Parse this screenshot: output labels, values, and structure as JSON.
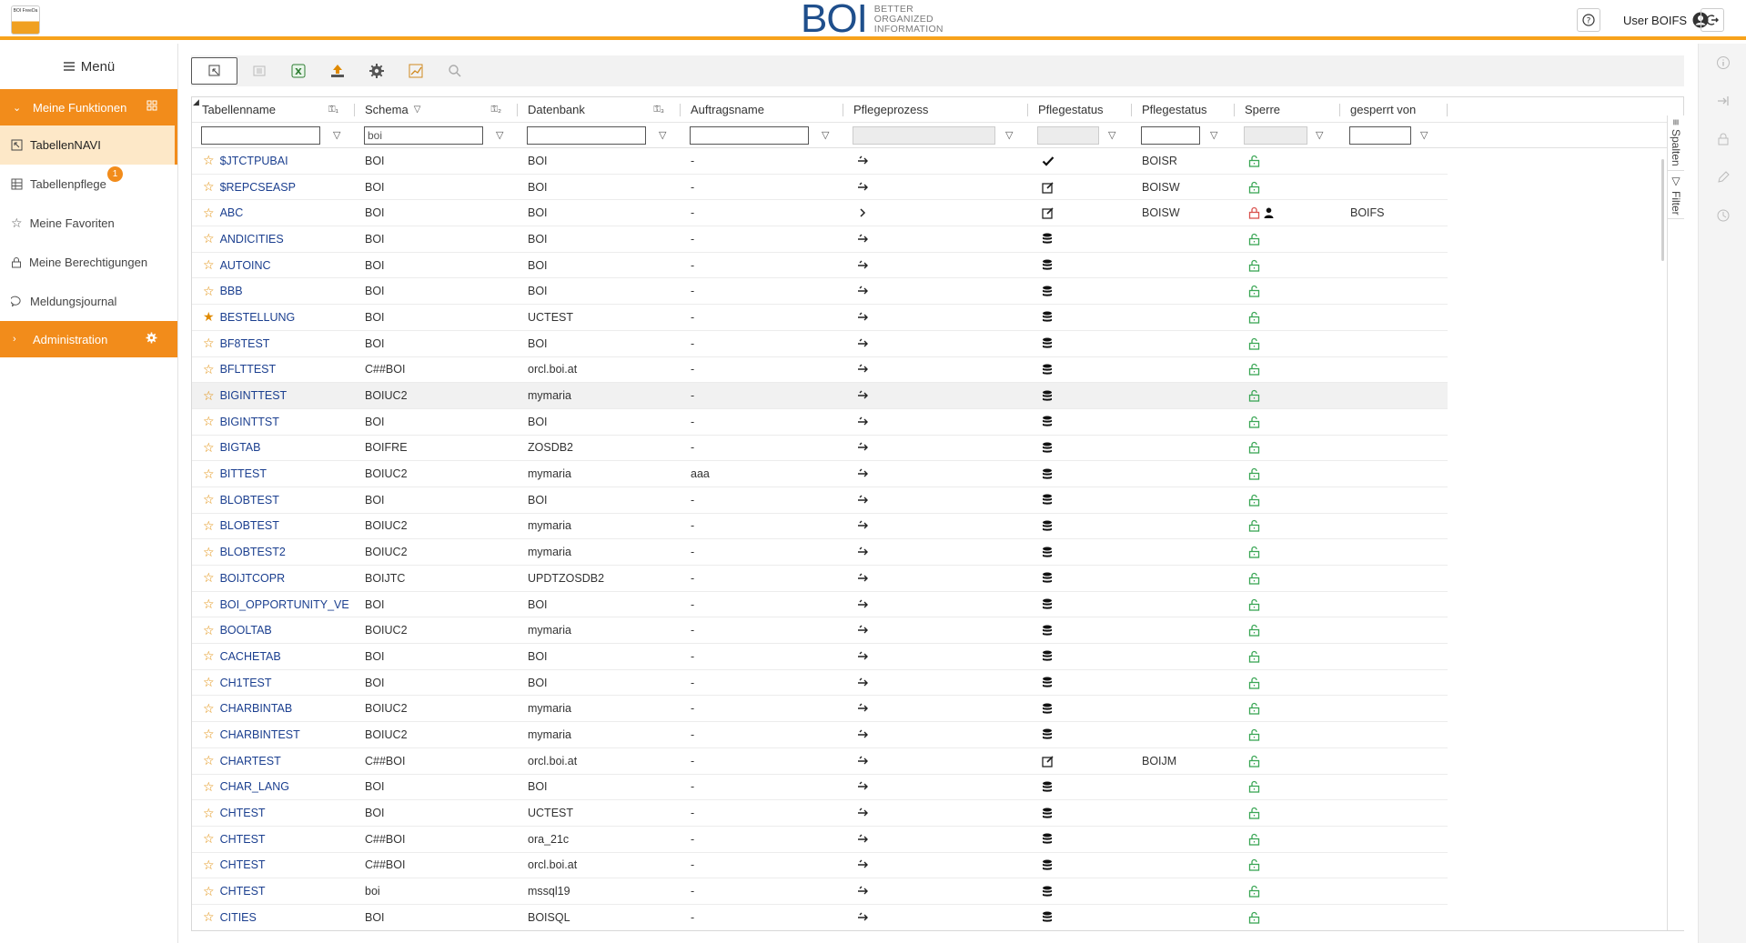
{
  "header": {
    "app_logo_text": "BOI FreeDa",
    "brand": "BOI",
    "brand_sub": [
      "BETTER",
      "ORGANIZED",
      "INFORMATION"
    ],
    "user_label": "User BOIFS"
  },
  "sidebar": {
    "menu_label": "Menü",
    "section_functions": "Meine Funktionen",
    "items": [
      {
        "label": "TabellenNAVI",
        "icon": "table-navi-icon",
        "active": true
      },
      {
        "label": "Tabellenpflege",
        "icon": "table-edit-icon",
        "badge": "1"
      },
      {
        "label": "Meine Favoriten",
        "icon": "star-icon"
      },
      {
        "label": "Meine Berechtigungen",
        "icon": "lock-icon"
      },
      {
        "label": "Meldungsjournal",
        "icon": "chat-icon"
      }
    ],
    "section_admin": "Administration"
  },
  "toolbar": {
    "buttons": [
      "select-mode",
      "details",
      "export-excel",
      "upload",
      "settings",
      "chart",
      "search"
    ]
  },
  "grid": {
    "columns": [
      "Tabellenname",
      "Schema",
      "Datenbank",
      "Auftragsname",
      "Pflegeprozess",
      "Pflegestatus",
      "Pflegestatus",
      "Sperre",
      "gesperrt von"
    ],
    "filters": {
      "schema_value": "boi"
    },
    "side_tabs": [
      "Spalten",
      "Filter"
    ],
    "rows": [
      {
        "name": "$JTCTPUBAI",
        "schema": "BOI",
        "db": "BOI",
        "auftrag": "-",
        "proc": "arrow",
        "status": "check",
        "status2": "BOISR",
        "lock": "open",
        "by": "",
        "fav": false
      },
      {
        "name": "$REPCSEASP",
        "schema": "BOI",
        "db": "BOI",
        "auftrag": "-",
        "proc": "arrow",
        "status": "edit",
        "status2": "BOISW",
        "lock": "open",
        "by": "",
        "fav": false
      },
      {
        "name": "ABC",
        "schema": "BOI",
        "db": "BOI",
        "auftrag": "-",
        "proc": "chevron",
        "status": "edit",
        "status2": "BOISW",
        "lock": "closed",
        "by": "BOIFS",
        "fav": false
      },
      {
        "name": "ANDICITIES",
        "schema": "BOI",
        "db": "BOI",
        "auftrag": "-",
        "proc": "arrow",
        "status": "db",
        "status2": "",
        "lock": "open",
        "by": "",
        "fav": false
      },
      {
        "name": "AUTOINC",
        "schema": "BOI",
        "db": "BOI",
        "auftrag": "-",
        "proc": "arrow",
        "status": "db",
        "status2": "",
        "lock": "open",
        "by": "",
        "fav": false
      },
      {
        "name": "BBB",
        "schema": "BOI",
        "db": "BOI",
        "auftrag": "-",
        "proc": "arrow",
        "status": "db",
        "status2": "",
        "lock": "open",
        "by": "",
        "fav": false
      },
      {
        "name": "BESTELLUNG",
        "schema": "BOI",
        "db": "UCTEST",
        "auftrag": "-",
        "proc": "arrow",
        "status": "db",
        "status2": "",
        "lock": "open",
        "by": "",
        "fav": true
      },
      {
        "name": "BF8TEST",
        "schema": "BOI",
        "db": "BOI",
        "auftrag": "-",
        "proc": "arrow",
        "status": "db",
        "status2": "",
        "lock": "open",
        "by": "",
        "fav": false
      },
      {
        "name": "BFLTTEST",
        "schema": "C##BOI",
        "db": "orcl.boi.at",
        "auftrag": "-",
        "proc": "arrow",
        "status": "db",
        "status2": "",
        "lock": "open",
        "by": "",
        "fav": false
      },
      {
        "name": "BIGINTTEST",
        "schema": "BOIUC2",
        "db": "mymaria",
        "auftrag": "-",
        "proc": "arrow",
        "status": "db",
        "status2": "",
        "lock": "open",
        "by": "",
        "fav": false,
        "hl": true
      },
      {
        "name": "BIGINTTST",
        "schema": "BOI",
        "db": "BOI",
        "auftrag": "-",
        "proc": "arrow",
        "status": "db",
        "status2": "",
        "lock": "open",
        "by": "",
        "fav": false
      },
      {
        "name": "BIGTAB",
        "schema": "BOIFRE",
        "db": "ZOSDB2",
        "auftrag": "-",
        "proc": "arrow",
        "status": "db",
        "status2": "",
        "lock": "open",
        "by": "",
        "fav": false
      },
      {
        "name": "BITTEST",
        "schema": "BOIUC2",
        "db": "mymaria",
        "auftrag": "aaa",
        "proc": "arrow",
        "status": "db",
        "status2": "",
        "lock": "open",
        "by": "",
        "fav": false
      },
      {
        "name": "BLOBTEST",
        "schema": "BOI",
        "db": "BOI",
        "auftrag": "-",
        "proc": "arrow",
        "status": "db",
        "status2": "",
        "lock": "open",
        "by": "",
        "fav": false
      },
      {
        "name": "BLOBTEST",
        "schema": "BOIUC2",
        "db": "mymaria",
        "auftrag": "-",
        "proc": "arrow",
        "status": "db",
        "status2": "",
        "lock": "open",
        "by": "",
        "fav": false
      },
      {
        "name": "BLOBTEST2",
        "schema": "BOIUC2",
        "db": "mymaria",
        "auftrag": "-",
        "proc": "arrow",
        "status": "db",
        "status2": "",
        "lock": "open",
        "by": "",
        "fav": false
      },
      {
        "name": "BOIJTCOPR",
        "schema": "BOIJTC",
        "db": "UPDTZOSDB2",
        "auftrag": "-",
        "proc": "arrow",
        "status": "db",
        "status2": "",
        "lock": "open",
        "by": "",
        "fav": false
      },
      {
        "name": "BOI_OPPORTUNITY_VE",
        "schema": "BOI",
        "db": "BOI",
        "auftrag": "-",
        "proc": "arrow",
        "status": "db",
        "status2": "",
        "lock": "open",
        "by": "",
        "fav": false
      },
      {
        "name": "BOOLTAB",
        "schema": "BOIUC2",
        "db": "mymaria",
        "auftrag": "-",
        "proc": "arrow",
        "status": "db",
        "status2": "",
        "lock": "open",
        "by": "",
        "fav": false
      },
      {
        "name": "CACHETAB",
        "schema": "BOI",
        "db": "BOI",
        "auftrag": "-",
        "proc": "arrow",
        "status": "db",
        "status2": "",
        "lock": "open",
        "by": "",
        "fav": false
      },
      {
        "name": "CH1TEST",
        "schema": "BOI",
        "db": "BOI",
        "auftrag": "-",
        "proc": "arrow",
        "status": "db",
        "status2": "",
        "lock": "open",
        "by": "",
        "fav": false
      },
      {
        "name": "CHARBINTAB",
        "schema": "BOIUC2",
        "db": "mymaria",
        "auftrag": "-",
        "proc": "arrow",
        "status": "db",
        "status2": "",
        "lock": "open",
        "by": "",
        "fav": false
      },
      {
        "name": "CHARBINTEST",
        "schema": "BOIUC2",
        "db": "mymaria",
        "auftrag": "-",
        "proc": "arrow",
        "status": "db",
        "status2": "",
        "lock": "open",
        "by": "",
        "fav": false
      },
      {
        "name": "CHARTEST",
        "schema": "C##BOI",
        "db": "orcl.boi.at",
        "auftrag": "-",
        "proc": "arrow",
        "status": "edit",
        "status2": "BOIJM",
        "lock": "open",
        "by": "",
        "fav": false
      },
      {
        "name": "CHAR_LANG",
        "schema": "BOI",
        "db": "BOI",
        "auftrag": "-",
        "proc": "arrow",
        "status": "db",
        "status2": "",
        "lock": "open",
        "by": "",
        "fav": false
      },
      {
        "name": "CHTEST",
        "schema": "BOI",
        "db": "UCTEST",
        "auftrag": "-",
        "proc": "arrow",
        "status": "db",
        "status2": "",
        "lock": "open",
        "by": "",
        "fav": false
      },
      {
        "name": "CHTEST",
        "schema": "C##BOI",
        "db": "ora_21c",
        "auftrag": "-",
        "proc": "arrow",
        "status": "db",
        "status2": "",
        "lock": "open",
        "by": "",
        "fav": false
      },
      {
        "name": "CHTEST",
        "schema": "C##BOI",
        "db": "orcl.boi.at",
        "auftrag": "-",
        "proc": "arrow",
        "status": "db",
        "status2": "",
        "lock": "open",
        "by": "",
        "fav": false
      },
      {
        "name": "CHTEST",
        "schema": "boi",
        "db": "mssql19",
        "auftrag": "-",
        "proc": "arrow",
        "status": "db",
        "status2": "",
        "lock": "open",
        "by": "",
        "fav": false
      },
      {
        "name": "CITIES",
        "schema": "BOI",
        "db": "BOISQL",
        "auftrag": "-",
        "proc": "arrow",
        "status": "db",
        "status2": "",
        "lock": "open",
        "by": "",
        "fav": false
      }
    ]
  },
  "colors": {
    "accent": "#f28c1b",
    "brand": "#1f4f8c",
    "link": "#1b3f8f",
    "lock_open": "#3aa655",
    "lock_closed": "#d9534f"
  }
}
